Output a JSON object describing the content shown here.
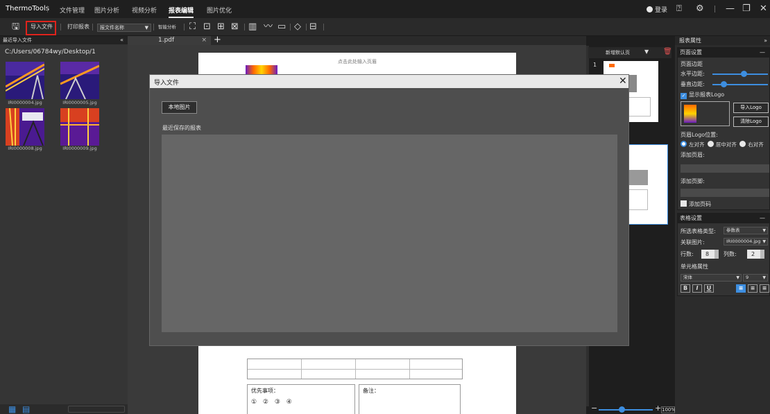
{
  "app": {
    "name": "ThermoTools"
  },
  "menu": [
    "文件管理",
    "图片分析",
    "视频分析",
    "报表编辑",
    "图片优化"
  ],
  "menu_active_index": 3,
  "account": {
    "login_label": "登录"
  },
  "window_icons": {
    "help": "help-icon",
    "settings": "settings-icon",
    "minimize": "minimize-icon",
    "restore": "restore-icon",
    "close": "close-icon"
  },
  "toolbar": {
    "import_label": "导入文件",
    "print_label": "打印报表",
    "template_select": "报文件名称",
    "smart_label": "智能分析"
  },
  "left_panel": {
    "title": "最近导入文件",
    "path": "C:/Users/06784wy/Desktop/1",
    "files": [
      "IRI0000004.jpg",
      "IRI0000005.jpg",
      "IRI0000008.jpg",
      "IRI0000009.jpg"
    ]
  },
  "center": {
    "tab_label": "1.pdf",
    "page_header_hint": "点击此处输入页眉",
    "priority_label": "优先事项：",
    "priority_options": "① ② ③ ④",
    "remark_label": "备注："
  },
  "dialog": {
    "title": "导入文件",
    "local_button": "本地图片",
    "recent_label": "最近保存的报表"
  },
  "thumbnails_panel": {
    "new_label": "新增默认页",
    "page_number": "1",
    "zoom": "100%"
  },
  "right_panel": {
    "title": "报表属性",
    "page_settings": {
      "title": "页面设置",
      "margin_label": "页面边距",
      "h_margin": "水平边距:",
      "v_margin": "垂直边距:",
      "show_logo": "显示报表Logo",
      "import_logo": "导入Logo",
      "clear_logo": "清除Logo",
      "logo_pos": "页眉Logo位置:",
      "align_left": "左对齐",
      "align_center": "居中对齐",
      "align_right": "右对齐",
      "add_header": "添加页眉:",
      "add_footer": "添加页脚:",
      "add_page_no": "添加页码"
    },
    "table_settings": {
      "title": "表格设置",
      "type_label": "所选表格类型:",
      "type_value": "参数表",
      "image_label": "关联图片:",
      "image_value": "IRI0000004.jpg",
      "rows_label": "行数:",
      "rows_value": "8",
      "cols_label": "列数:",
      "cols_value": "2",
      "cell_attr": "单元格属性",
      "font_value": "宋体",
      "size_value": "9"
    }
  },
  "colors": {
    "accent": "#3d8ee0",
    "highlight": "#e0231c"
  }
}
